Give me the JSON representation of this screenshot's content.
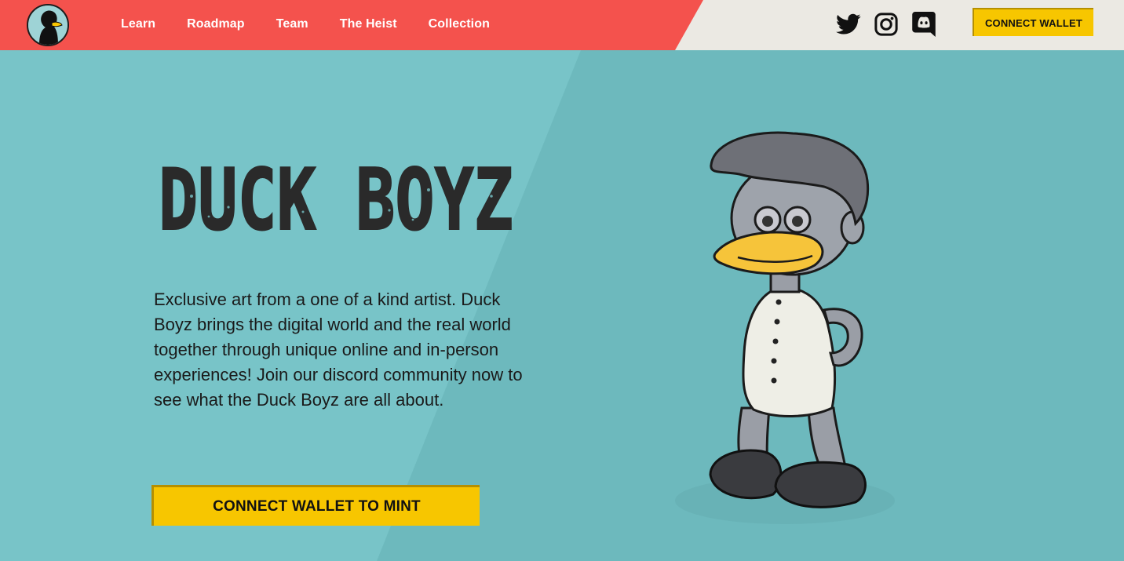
{
  "header": {
    "nav": [
      {
        "label": "Learn"
      },
      {
        "label": "Roadmap"
      },
      {
        "label": "Team"
      },
      {
        "label": "The Heist"
      },
      {
        "label": "Collection"
      }
    ],
    "social_icons": [
      "twitter-icon",
      "instagram-icon",
      "discord-icon"
    ],
    "connect_wallet_label": "CONNECT WALLET"
  },
  "hero": {
    "logo_text": "DUCK BOYZ",
    "description": "Exclusive art from a one of a kind artist. Duck Boyz brings the digital world and the real world together through unique online and in-person experiences! Join our discord community now to see what the Duck Boyz are all about.",
    "mint_button_label": "CONNECT WALLET TO MINT"
  },
  "colors": {
    "background_teal": "#78c4c8",
    "nav_red": "#f4524d",
    "nav_cream": "#ebe9e3",
    "button_yellow": "#f7c600"
  }
}
